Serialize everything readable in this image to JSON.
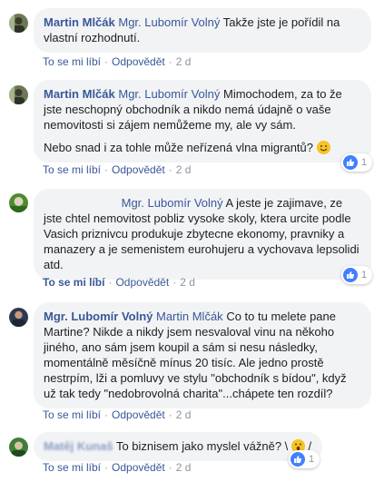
{
  "comments": [
    {
      "author": "Martin Mlčák",
      "mention": "Mgr. Lubomír Volný",
      "text": "Takže jste je pořídil na vlastní rozhodnutí.",
      "like": "To se mi líbí",
      "reply": "Odpovědět",
      "time": "2 d"
    },
    {
      "author": "Martin Mlčák",
      "mention": "Mgr. Lubomír Volný",
      "text": "Mimochodem, za to že jste neschopný obchodník a nikdo nemá údajně o vaše nemovitosti si zájem nemůžeme my, ale vy sám.",
      "text2": "Nebo snad i za tohle může neřízená vlna migrantů?",
      "like": "To se mi líbí",
      "reply": "Odpovědět",
      "time": "2 d",
      "reactions": "1"
    },
    {
      "author": "",
      "mention": "Mgr. Lubomír Volný",
      "text": "A jeste je zajimave, ze jste chtel nemovitost pobliz vysoke skoly, ktera urcite podle Vasich priznivcu produkuje zbytecne ekonomy, pravniky a manazery a je semenistem eurohujeru a vychovava lepsolidi atd.",
      "like": "To se mi líbí",
      "reply": "Odpovědět",
      "time": "2 d",
      "reactions": "1"
    },
    {
      "author": "Mgr. Lubomír Volný",
      "mention": "Martin Mlčák",
      "text": "Co to tu melete pane Martine? Nikde a nikdy jsem nesvaloval vinu na někoho jiného, ano sám jsem koupil a sám si nesu následky, momentálně měsíčně mínus 20 tisíc. Ale jedno prostě nestrpím, lži a pomluvy ve stylu \"obchodník s bídou\", když už tak tedy \"nedobrovolná charita\"...chápete ten rozdíl?",
      "like": "To se mi líbí",
      "reply": "Odpovědět",
      "time": "2 d"
    },
    {
      "author": "Matěj Kunaš",
      "mention": "",
      "text": "To biznisem jako myslel vážně? \\",
      "text_end": "/",
      "like": "To se mi líbí",
      "reply": "Odpovědět",
      "time": "2 d",
      "reactions": "1"
    }
  ],
  "colors": {
    "link": "#385898",
    "bubble": "#f2f3f5",
    "meta": "#90949c",
    "like": "#4080ff"
  }
}
